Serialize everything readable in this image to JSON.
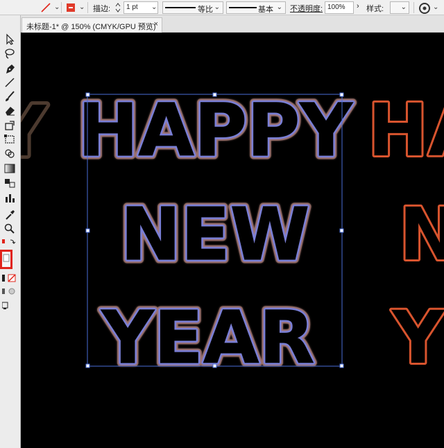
{
  "control_bar": {
    "stroke_color_icon": "no-fill-slash-icon",
    "fill_swatch_color": "#e03a2a",
    "stroke_label": "描边:",
    "stroke_weight": "1 pt",
    "profile_label": "等比",
    "brush_label": "基本",
    "opacity_label": "不透明度:",
    "opacity_value": "100%",
    "style_label": "样式:"
  },
  "document_tab": {
    "title": "未标题-1* @ 150% (CMYK/GPU 预览)",
    "close_glyph": "×"
  },
  "canvas": {
    "background": "#000000",
    "lines": [
      "HAPPY",
      "NEW",
      "YEAR"
    ],
    "copy_left_visible": "Y",
    "copy_right_line1": "HA",
    "copy_right_line2": "N",
    "copy_right_line3": "Y",
    "main_stroke_color": "#7a7fd6",
    "main_glow_color": "#c08a80",
    "left_copy_color": "#8a6a56",
    "right_copy_color": "#d8542e",
    "selection_color": "#4a6ed8"
  }
}
